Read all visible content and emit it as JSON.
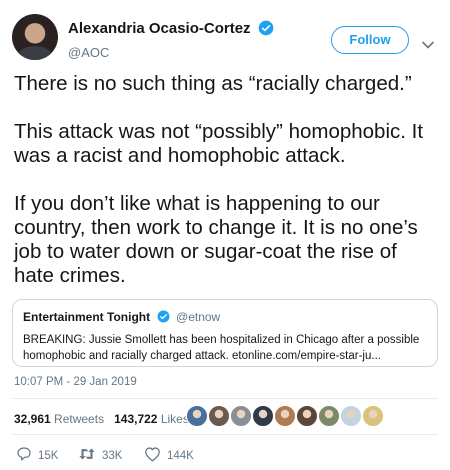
{
  "author": {
    "name": "Alexandria Ocasio-Cortez",
    "handle": "@AOC",
    "follow_label": "Follow"
  },
  "tweet": {
    "paragraphs": [
      "There is no such thing as “racially charged.”",
      "This attack was not “possibly” homophobic. It was a racist and homophobic attack.",
      "If you don’t like what is happening to our country, then work to change it. It is no one’s job to water down or sugar-coat the rise of hate crimes."
    ]
  },
  "quote": {
    "name": "Entertainment Tonight",
    "handle": "@etnow",
    "line1": "BREAKING: Jussie Smollett has been hospitalized in Chicago after a possible",
    "line2": "homophobic and racially charged attack. etonline.com/empire-star-ju..."
  },
  "timestamp": "10:07 PM - 29 Jan 2019",
  "stats": {
    "retweets_count": "32,961",
    "retweets_label": "Retweets",
    "likes_count": "143,722",
    "likes_label": "Likes"
  },
  "likers": {
    "avatar_colors": [
      "#4a6f9c",
      "#6b5a4e",
      "#8a8f96",
      "#2f3b48",
      "#b07a54",
      "#5b4638",
      "#7d8a6a",
      "#c4d3e0",
      "#d9c27a"
    ]
  },
  "actions": {
    "reply_count": "15K",
    "retweet_count": "33K",
    "like_count": "144K"
  },
  "colors": {
    "accent": "#1da1f2",
    "text": "#14171a",
    "muted": "#657786",
    "border": "#ccd6dd"
  }
}
